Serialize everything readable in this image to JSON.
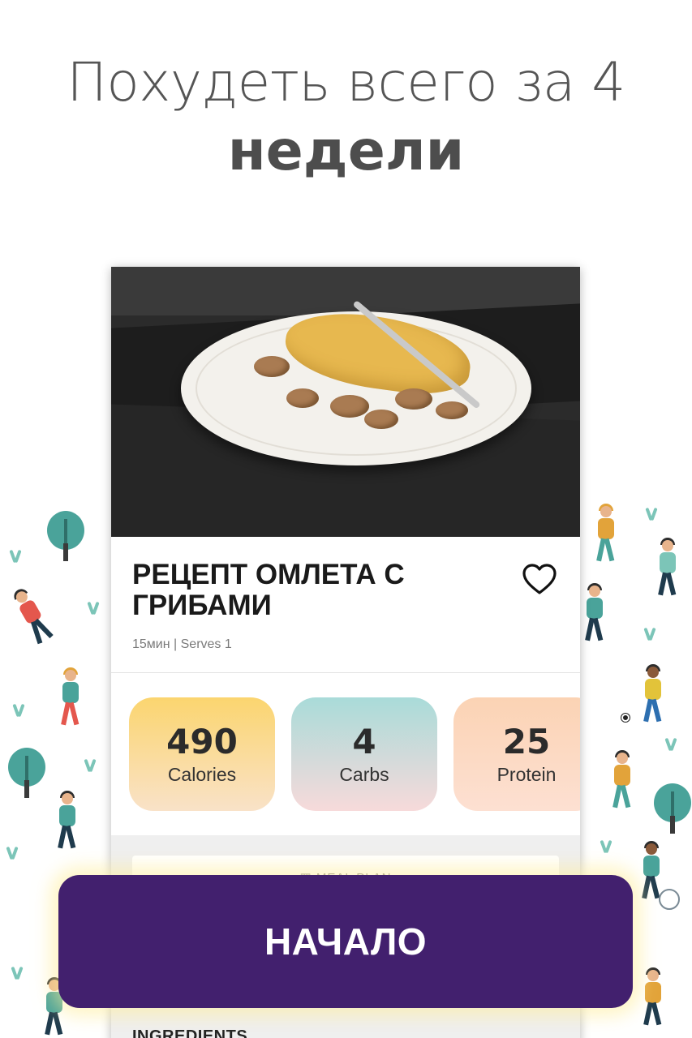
{
  "headline": {
    "line1": "Похудеть всего за 4",
    "line2": "недели"
  },
  "recipe": {
    "title": "РЕЦЕПТ ОМЛЕТА С ГРИБАМИ",
    "meta": "15мин | Serves 1",
    "favorite_icon": "heart-outline-icon"
  },
  "stats": [
    {
      "value": "490",
      "label": "Calories"
    },
    {
      "value": "4",
      "label": "Carbs"
    },
    {
      "value": "25",
      "label": "Protein"
    }
  ],
  "meal_plan": {
    "icon": "calendar-icon",
    "label": "MEAL PLAN"
  },
  "ingredients_heading": "INGREDIENTS",
  "cta": {
    "label": "НАЧАЛО",
    "color": "#42206e"
  },
  "colors": {
    "headline": "#555555",
    "tree": "#4aa39a",
    "calories_gradient_top": "#fbd56f",
    "carbs_gradient_top": "#a9dbd9",
    "protein_gradient_top": "#fbd3b4"
  }
}
